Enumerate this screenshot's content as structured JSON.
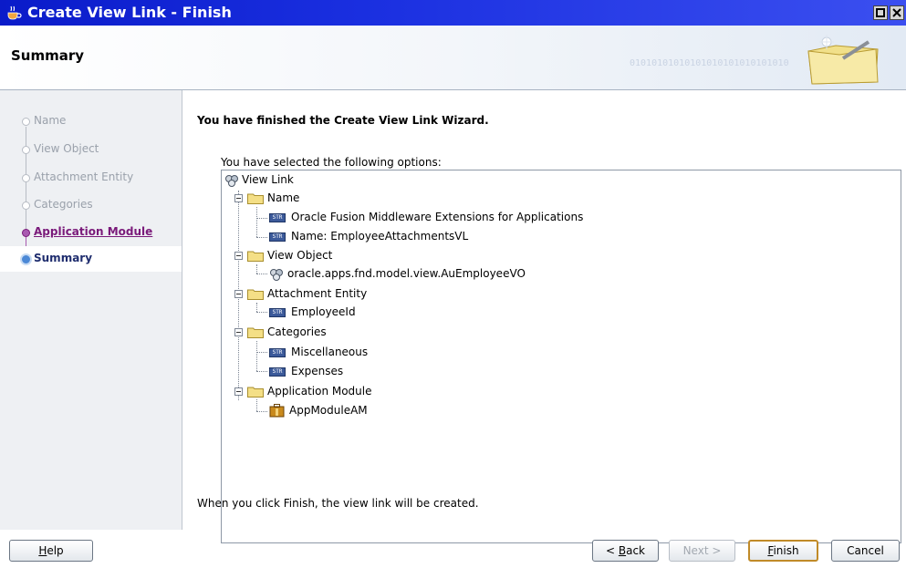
{
  "window": {
    "title": "Create View Link - Finish"
  },
  "header": {
    "title": "Summary",
    "binary_text": "01010101010101010101010101010"
  },
  "steps": [
    {
      "label": "Name",
      "state": "pending"
    },
    {
      "label": "View Object",
      "state": "pending"
    },
    {
      "label": "Attachment Entity",
      "state": "pending"
    },
    {
      "label": "Categories",
      "state": "pending"
    },
    {
      "label": "Application Module",
      "state": "visited"
    },
    {
      "label": "Summary",
      "state": "current"
    }
  ],
  "content": {
    "finish_message": "You have finished the Create View Link Wizard.",
    "selected_label": "You have selected the following options:",
    "bottom_message": "When you click Finish, the view link will be created."
  },
  "tree": {
    "root": "View Link",
    "name_group": "Name",
    "name_item_1": "Oracle Fusion Middleware Extensions for Applications",
    "name_item_2": "Name: EmployeeAttachmentsVL",
    "view_object_group": "View Object",
    "view_object_item": "oracle.apps.fnd.model.view.AuEmployeeVO",
    "attachment_group": "Attachment Entity",
    "attachment_item": "EmployeeId",
    "categories_group": "Categories",
    "categories_item_1": "Miscellaneous",
    "categories_item_2": "Expenses",
    "app_module_group": "Application Module",
    "app_module_item": "AppModuleAM",
    "attr_badge": "STR"
  },
  "buttons": {
    "help_mn": "H",
    "help_rest": "elp",
    "back_prefix": "< ",
    "back_mn": "B",
    "back_rest": "ack",
    "next": "Next >",
    "finish_mn": "F",
    "finish_rest": "inish",
    "cancel": "Cancel"
  },
  "colors": {
    "titlebar": "#0a1bc9",
    "visited_step": "#7a1a7a",
    "current_step": "#1f2d6e",
    "default_button_border": "#c08a28"
  }
}
